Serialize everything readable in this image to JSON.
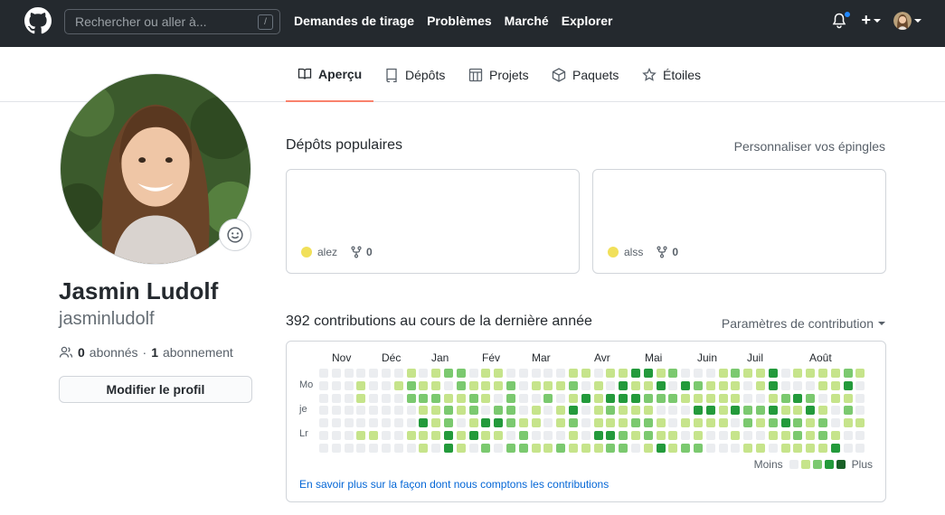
{
  "topbar": {
    "search_placeholder": "Rechercher ou aller à...",
    "search_shortcut": "/",
    "nav": [
      "Demandes de tirage",
      "Problèmes",
      "Marché",
      "Explorer"
    ],
    "plus": "+"
  },
  "tabs": [
    {
      "label": "Aperçu",
      "icon": "book-icon",
      "active": true
    },
    {
      "label": "Dépôts",
      "icon": "repo-icon",
      "active": false
    },
    {
      "label": "Projets",
      "icon": "project-icon",
      "active": false
    },
    {
      "label": "Paquets",
      "icon": "package-icon",
      "active": false
    },
    {
      "label": "Étoiles",
      "icon": "star-icon",
      "active": false
    }
  ],
  "profile": {
    "full_name": "Jasmin Ludolf",
    "username": "jasminludolf",
    "followers_count": "0",
    "followers_label": "abonnés",
    "separator": "·",
    "following_count": "1",
    "following_label": "abonnement",
    "edit_button": "Modifier le profil"
  },
  "popular": {
    "title": "Dépôts populaires",
    "customize_link": "Personnaliser vos épingles",
    "repos": [
      {
        "language": "alez",
        "forks": "0"
      },
      {
        "language": "alss",
        "forks": "0"
      }
    ]
  },
  "contributions": {
    "title": "392 contributions au cours de la dernière année",
    "settings": "Paramètres de contribution",
    "months": [
      "Nov",
      "Déc",
      "Jan",
      "Fév",
      "Mar",
      "Avr",
      "Mai",
      "Juin",
      "Juil",
      "Août"
    ],
    "day_labels": [
      "Mo",
      "je",
      "Lr"
    ],
    "legend_less": "Moins",
    "legend_more": "Plus",
    "learn_more": "En savoir plus sur la façon dont nous comptons les contributions",
    "colors": [
      "#ebedf0",
      "#c6e48b",
      "#7bc96f",
      "#239a3b",
      "#196127"
    ]
  }
}
